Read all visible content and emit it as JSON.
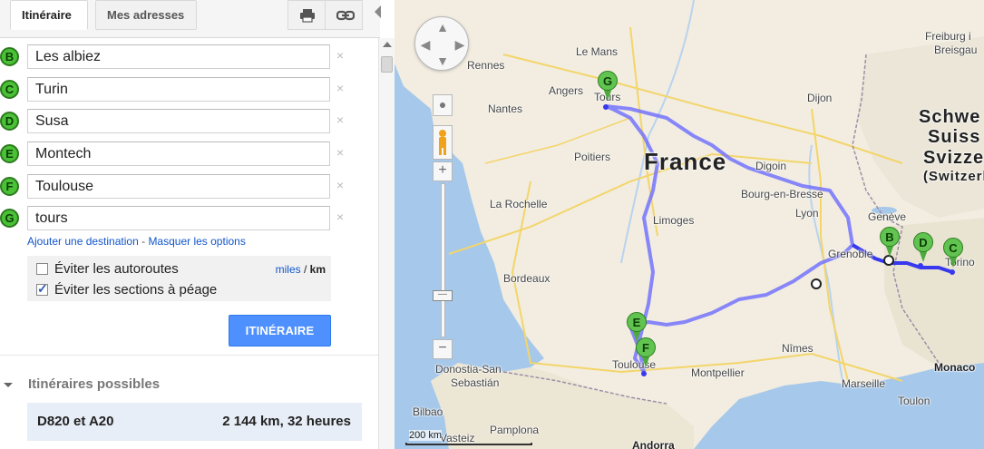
{
  "tabs": {
    "itineraire": "Itinéraire",
    "adresses": "Mes adresses",
    "print_icon": "print-icon",
    "link_icon": "link-icon"
  },
  "destinations": [
    {
      "letter": "B",
      "value": "Les albiez"
    },
    {
      "letter": "C",
      "value": "Turin"
    },
    {
      "letter": "D",
      "value": "Susa"
    },
    {
      "letter": "E",
      "value": "Montech"
    },
    {
      "letter": "F",
      "value": "Toulouse"
    },
    {
      "letter": "G",
      "value": "tours"
    }
  ],
  "remove_glyph": "×",
  "links": {
    "add_destination": "Ajouter une destination",
    "separator": " - ",
    "hide_options": "Masquer les options"
  },
  "options": {
    "avoid_highways": {
      "label": "Éviter les autoroutes",
      "checked": false
    },
    "avoid_tolls": {
      "label": "Éviter les sections à péage",
      "checked": true
    },
    "units_miles": "miles",
    "units_sep": " / ",
    "units_km": "km"
  },
  "itin_button": "ITINÉRAIRE",
  "routes": {
    "title": "Itinéraires possibles",
    "items": [
      {
        "name": "D820 et A20",
        "summary": "2 144 km, 32 heures"
      }
    ]
  },
  "map": {
    "route_color": "#6b6bff",
    "pins": [
      {
        "letter": "G"
      },
      {
        "letter": "B"
      },
      {
        "letter": "D"
      },
      {
        "letter": "C"
      },
      {
        "letter": "E"
      },
      {
        "letter": "F"
      }
    ],
    "labels": {
      "le_mans": "Le Mans",
      "rennes": "Rennes",
      "angers": "Angers",
      "tours": "Tours",
      "nantes": "Nantes",
      "poitiers": "Poitiers",
      "la_rochelle": "La Rochelle",
      "limoges": "Limoges",
      "bordeaux": "Bordeaux",
      "dijon": "Dijon",
      "digoin": "Digoin",
      "bourg": "Bourg-en-Bresse",
      "lyon": "Lyon",
      "geneve": "Genève",
      "grenoble": "Grenoble",
      "torino": "Torino",
      "nimes": "Nîmes",
      "montpellier": "Montpellier",
      "marseille": "Marseille",
      "toulon": "Toulon",
      "monaco": "Monaco",
      "toulouse": "Toulouse",
      "donostia": "Donostia-San",
      "sebastian": "Sebastián",
      "bilbao": "Bilbao",
      "pamplona": "Pamplona",
      "vasteiz": "Vasteiz",
      "andorra": "Andorra",
      "freiburg": "Freiburg i",
      "breisgau": "Breisgau",
      "france": "France",
      "schweiz": "Schwe",
      "suisse": "Suiss",
      "svizzera": "Svizze",
      "switzerland": "(Switzerl"
    },
    "scale": "200 km"
  }
}
